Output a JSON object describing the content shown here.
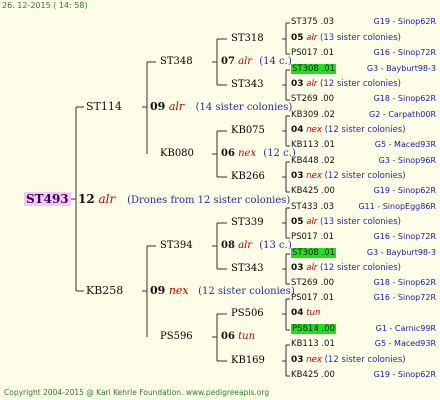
{
  "date": "26. 12-2015 ( 14: 58)",
  "footer": "Copyright 2004-2015 @ Karl Kehrle Foundation.   www.pedigreeapis.org",
  "root": {
    "name": "ST493",
    "num": "12",
    "drone": "alr",
    "sisters": "(Drones from 12 sister colonies)"
  },
  "p1": {
    "name": "ST114",
    "num": "09",
    "drone": "alr",
    "sisters": "(14 sister colonies)"
  },
  "p2": {
    "name": "KB258",
    "num": "09",
    "drone": "nex",
    "sisters": "(12 sister colonies)"
  },
  "g1": {
    "name": "ST348",
    "num": "07",
    "drone": "alr",
    "sisters": "(14 c.)"
  },
  "g2": {
    "name": "KB080",
    "num": "06",
    "drone": "nex",
    "sisters": "(12 c.)"
  },
  "g3": {
    "name": "ST394",
    "num": "08",
    "drone": "alr",
    "sisters": "(13 c.)"
  },
  "g4": {
    "name": "PS596",
    "num": "06",
    "drone": "tun",
    "sisters": ""
  },
  "h1": "ST318",
  "h2": "ST343",
  "h3": "KB075",
  "h4": "KB266",
  "h5": "ST339",
  "h6": "ST343",
  "h7": "PS506",
  "h8": "KB169",
  "gg": [
    {
      "top": {
        "name": "ST375",
        "val": ".03",
        "right": "G19 - Sinop62R"
      },
      "num": "05",
      "drone": "alr",
      "sisters": "(13 sister colonies)",
      "bot": {
        "name": "PS017",
        "val": ".01",
        "right": "G16 - Sinop72R"
      }
    },
    {
      "top": {
        "name": "ST308",
        "val": ".01",
        "right": "G3 - Bayburt98-3"
      },
      "num": "03",
      "drone": "alr",
      "sisters": "(12 sister colonies)",
      "bot": {
        "name": "ST269",
        "val": ".00",
        "right": "G18 - Sinop62R"
      }
    },
    {
      "top": {
        "name": "KB309",
        "val": ".02",
        "right": "G2 - Carpath00R"
      },
      "num": "04",
      "drone": "nex",
      "sisters": "(12 sister colonies)",
      "bot": {
        "name": "KB113",
        "val": ".01",
        "right": "G5 - Maced93R"
      }
    },
    {
      "top": {
        "name": "KB448",
        "val": ".02",
        "right": "G3 - Sinop96R"
      },
      "num": "03",
      "drone": "nex",
      "sisters": "(12 sister colonies)",
      "bot": {
        "name": "KB425",
        "val": ".00",
        "right": "G19 - Sinop62R"
      }
    },
    {
      "top": {
        "name": "ST433",
        "val": ".03",
        "right": "G11 - SinopEgg86R"
      },
      "num": "05",
      "drone": "alr",
      "sisters": "(13 sister colonies)",
      "bot": {
        "name": "PS017",
        "val": ".01",
        "right": "G16 - Sinop72R"
      }
    },
    {
      "top": {
        "name": "ST308",
        "val": ".01",
        "right": "G3 - Bayburt98-3"
      },
      "num": "03",
      "drone": "alr",
      "sisters": "(12 sister colonies)",
      "bot": {
        "name": "ST269",
        "val": ".00",
        "right": "G18 - Sinop62R"
      }
    },
    {
      "top": {
        "name": "PS017",
        "val": ".01",
        "right": "G16 - Sinop72R"
      },
      "num": "04",
      "drone": "tun",
      "sisters": "",
      "bot": {
        "name": "PS614",
        "val": ".00",
        "right": "G1 - Carnic99R"
      }
    },
    {
      "top": {
        "name": "KB113",
        "val": ".01",
        "right": "G5 - Maced93R"
      },
      "num": "03",
      "drone": "nex",
      "sisters": "(12 sister colonies)",
      "bot": {
        "name": "KB425",
        "val": ".00",
        "right": "G19 - Sinop62R"
      }
    }
  ]
}
